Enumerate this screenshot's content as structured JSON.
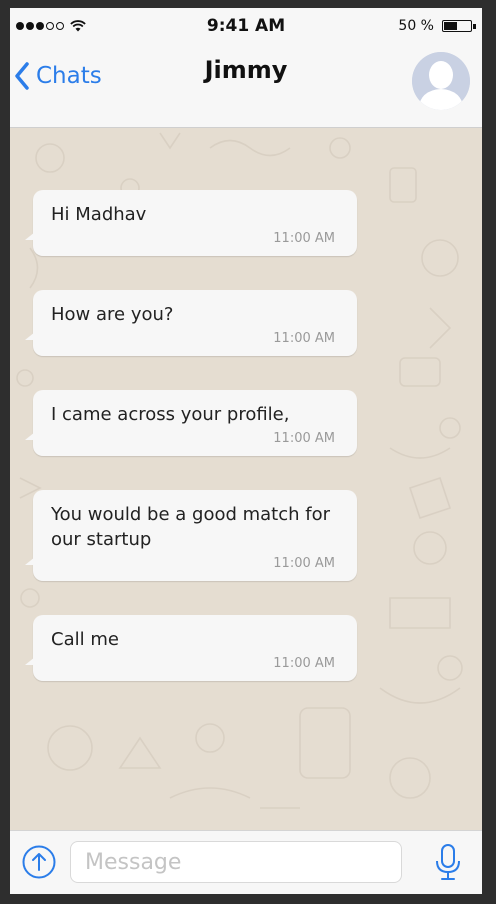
{
  "status_bar": {
    "signal_dots_filled": 3,
    "signal_dots_total": 5,
    "time": "9:41 AM",
    "battery_text": "50 %",
    "battery_level": 0.5
  },
  "header": {
    "back_label": "Chats",
    "contact_name": "Jimmy"
  },
  "messages": [
    {
      "text": "Hi Madhav",
      "time": "11:00 AM"
    },
    {
      "text": "How are you?",
      "time": "11:00 AM"
    },
    {
      "text": "I came across your profile,",
      "time": "11:00 AM"
    },
    {
      "text": "You would be a good match for our startup",
      "time": "11:00 AM"
    },
    {
      "text": "Call me",
      "time": "11:00 AM"
    }
  ],
  "composer": {
    "placeholder": "Message"
  },
  "colors": {
    "accent": "#2b7de9",
    "chat_background": "#e5ddd1",
    "bubble": "#f7f7f7"
  }
}
